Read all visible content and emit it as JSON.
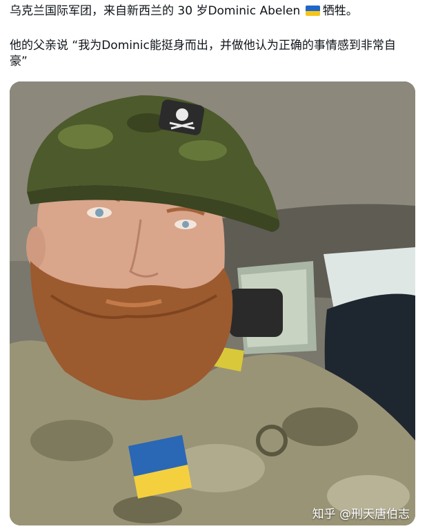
{
  "post": {
    "line1_before": "乌克兰国际军团，来自新西兰的 30 岁Dominic Abelen ",
    "line1_after": "牺牲。",
    "line2": "他的父亲说 “我为Dominic能挺身而出，并做他认为正确的事情感到非常自",
    "line3": "豪”",
    "flag_icon": "ukraine-flag-emoji"
  },
  "media": {
    "watermark": "知乎 @刑天唐伯志",
    "colors": {
      "flag_blue": "#1f66c9",
      "flag_yellow": "#f5c518"
    }
  }
}
